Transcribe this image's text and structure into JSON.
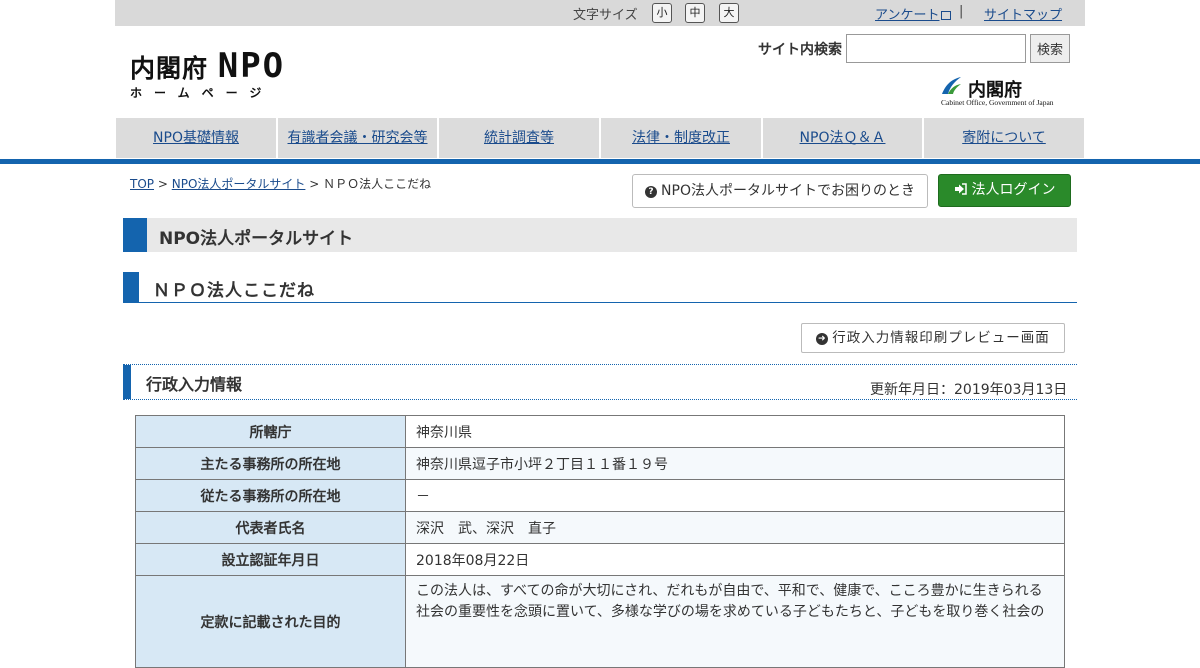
{
  "topbar": {
    "font_size_label": "文字サイズ",
    "font_small": "小",
    "font_medium": "中",
    "font_large": "大",
    "survey_link": "アンケート",
    "separator": "|",
    "sitemap_link": "サイトマップ"
  },
  "logo": {
    "line1_prefix": "内閣府",
    "line1_npo": "NPO",
    "line2": "ホームページ"
  },
  "search": {
    "label": "サイト内検索",
    "placeholder": "",
    "button": "検索"
  },
  "cabinet_office": {
    "name": "内閣府",
    "english": "Cabinet Office, Government of Japan"
  },
  "global_nav": [
    {
      "label": "NPO基礎情報"
    },
    {
      "label": "有識者会議・研究会等"
    },
    {
      "label": "統計調査等"
    },
    {
      "label": "法律・制度改正"
    },
    {
      "label": "NPO法Ｑ＆Ａ"
    },
    {
      "label": "寄附について"
    }
  ],
  "breadcrumb": {
    "top": "TOP",
    "portal": "NPO法人ポータルサイト",
    "current": "ＮＰＯ法人ここだね",
    "sep": ">"
  },
  "buttons": {
    "help": "NPO法人ポータルサイトでお困りのとき",
    "login": "法人ログイン",
    "print_preview": "行政入力情報印刷プレビュー画面"
  },
  "headings": {
    "portal": "NPO法人ポータルサイト",
    "corporation": "ＮＰＯ法人ここだね",
    "admin_info": "行政入力情報"
  },
  "updated": "更新年月日：2019年03月13日",
  "info_table": [
    {
      "label": "所轄庁",
      "value": "神奈川県"
    },
    {
      "label": "主たる事務所の所在地",
      "value": "神奈川県逗子市小坪２丁目１１番１９号"
    },
    {
      "label": "従たる事務所の所在地",
      "value": "－"
    },
    {
      "label": "代表者氏名",
      "value": "深沢　武、深沢　直子"
    },
    {
      "label": "設立認証年月日",
      "value": "2018年08月22日"
    },
    {
      "label": "定款に記載された目的",
      "value": "この法人は、すべての命が大切にされ、だれもが自由で、平和で、健康で、こころ豊かに生きられる社会の重要性を念頭に置いて、多様な学びの場を求めている子どもたちと、子どもを取り巻く社会の"
    }
  ],
  "colors": {
    "accent_blue": "#1464ae",
    "login_green": "#2a8a2a",
    "table_header_bg": "#d7e8f5"
  }
}
